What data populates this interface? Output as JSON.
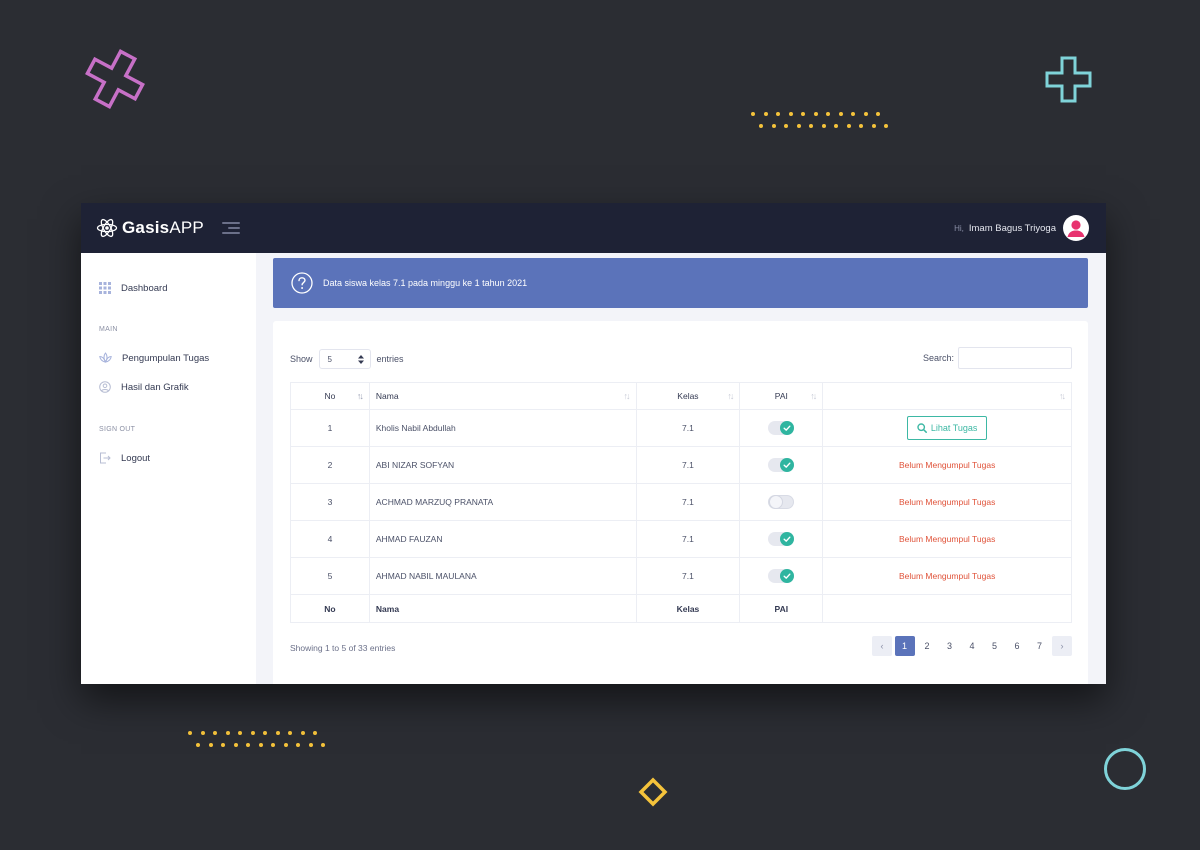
{
  "app": {
    "brand_bold": "Gasis",
    "brand_light": "APP"
  },
  "user": {
    "greeting": "Hi,",
    "name": "Imam Bagus Triyoga"
  },
  "sidebar": {
    "dashboard": "Dashboard",
    "section_main": "MAIN",
    "pengumpulan": "Pengumpulan Tugas",
    "hasil": "Hasil dan Grafik",
    "section_signout": "SIGN OUT",
    "logout": "Logout"
  },
  "alert": {
    "text": "Data siswa kelas 7.1 pada minggu ke 1 tahun 2021"
  },
  "controls": {
    "show": "Show",
    "entries_value": "5",
    "entries": "entries",
    "search": "Search:"
  },
  "table": {
    "headers": {
      "no": "No",
      "nama": "Nama",
      "kelas": "Kelas",
      "pai": "PAI",
      "action": ""
    },
    "rows": [
      {
        "no": "1",
        "nama": "Kholis Nabil Abdullah",
        "kelas": "7.1",
        "pai": true,
        "action": "Lihat Tugas"
      },
      {
        "no": "2",
        "nama": "ABI NIZAR SOFYAN",
        "kelas": "7.1",
        "pai": true,
        "action": "Belum Mengumpul Tugas"
      },
      {
        "no": "3",
        "nama": "ACHMAD MARZUQ PRANATA",
        "kelas": "7.1",
        "pai": false,
        "action": "Belum Mengumpul Tugas"
      },
      {
        "no": "4",
        "nama": "AHMAD FAUZAN",
        "kelas": "7.1",
        "pai": true,
        "action": "Belum Mengumpul Tugas"
      },
      {
        "no": "5",
        "nama": "AHMAD NABIL MAULANA",
        "kelas": "7.1",
        "pai": true,
        "action": "Belum Mengumpul Tugas"
      }
    ],
    "footer": {
      "no": "No",
      "nama": "Nama",
      "kelas": "Kelas",
      "pai": "PAI"
    }
  },
  "info": "Showing 1 to 5 of 33 entries",
  "pagination": {
    "pages": [
      "1",
      "2",
      "3",
      "4",
      "5",
      "6",
      "7"
    ],
    "active": "1"
  },
  "colors": {
    "background": "#2b2d33",
    "topbar": "#1e2235",
    "accent": "#5b73ba",
    "toggle_on": "#2fb5a0",
    "warning_text": "#e0533a",
    "deco_pink": "#c770c7",
    "deco_cyan": "#7fd3d9",
    "deco_yellow": "#f5c33b"
  }
}
